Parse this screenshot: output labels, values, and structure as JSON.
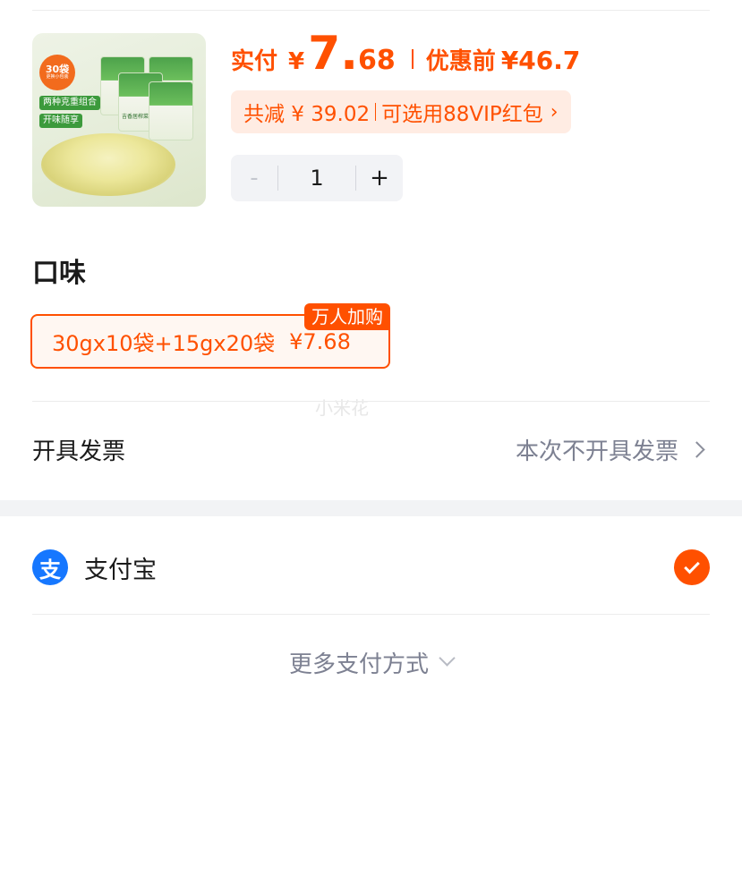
{
  "product": {
    "thumb_badge_count": "30袋",
    "thumb_badge_sub": "更换小包装",
    "thumb_tags": [
      "两种克重组合",
      "开味随享"
    ],
    "thumb_pack_label": "吉香居榨菜"
  },
  "price": {
    "paid_label": "实付",
    "currency": "¥",
    "paid_int": "7.",
    "paid_dec": "68",
    "before_label": "优惠前",
    "before_price": "¥46.7"
  },
  "discount": {
    "saved_text": "共减 ¥ 39.02",
    "vip_text": "可选用88VIP红包",
    "chevron": "›"
  },
  "quantity": {
    "minus": "-",
    "value": "1",
    "plus": "+"
  },
  "flavor": {
    "title": "口味",
    "option_label": "30gx10袋+15gx20袋",
    "option_price": "¥7.68",
    "option_badge": "万人加购"
  },
  "watermark": "小米花",
  "invoice": {
    "label": "开具发票",
    "value": "本次不开具发票"
  },
  "payment": {
    "method_icon_char": "支",
    "method_label": "支付宝",
    "more_label": "更多支付方式"
  },
  "colors": {
    "accent": "#ff5000",
    "alipay_blue": "#1677ff"
  }
}
